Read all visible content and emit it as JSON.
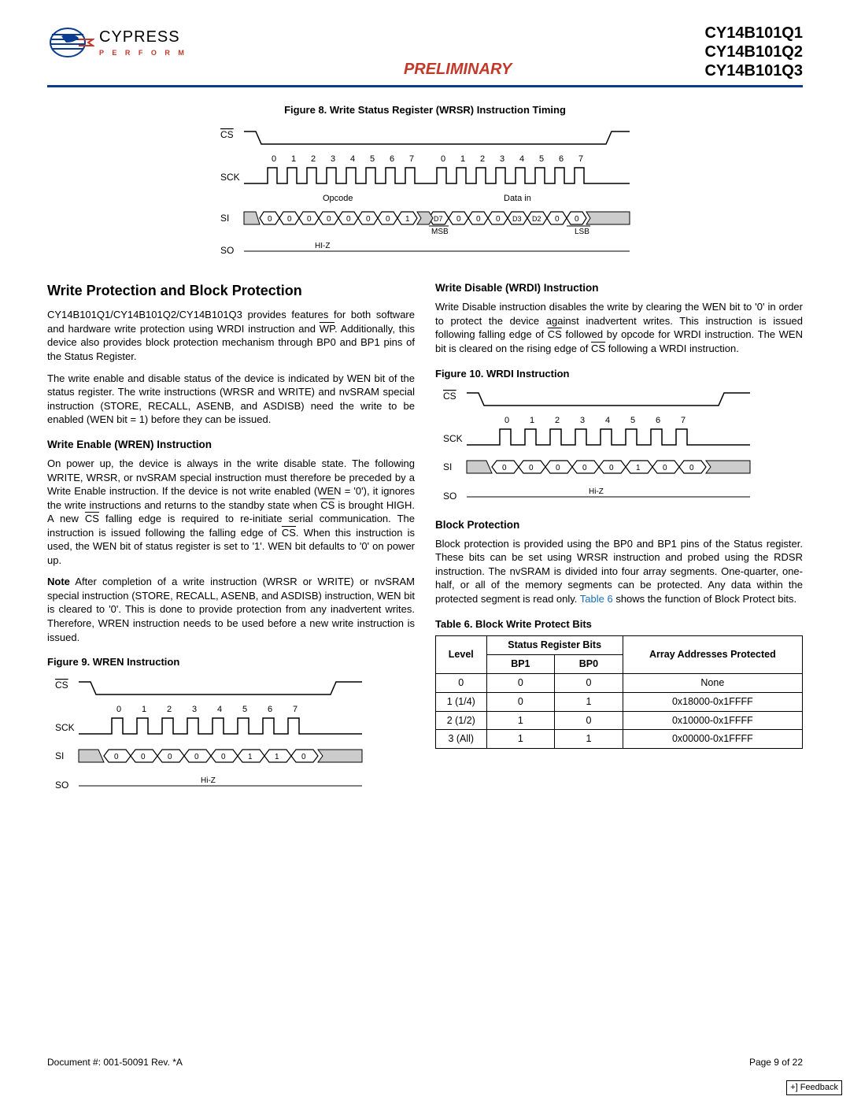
{
  "header": {
    "brand": "CYPRESS",
    "tagline": "P E R F O R M",
    "center": "PRELIMINARY",
    "parts": [
      "CY14B101Q1",
      "CY14B101Q2",
      "CY14B101Q3"
    ]
  },
  "fig8": {
    "caption": "Figure 8.  Write Status Register (WRSR) Instruction Timing",
    "sig_cs": "CS",
    "sig_sck": "SCK",
    "sig_si": "SI",
    "sig_so": "SO",
    "ticks_a": [
      "0",
      "1",
      "2",
      "3",
      "4",
      "5",
      "6",
      "7",
      "0",
      "1",
      "2",
      "3",
      "4",
      "5",
      "6",
      "7"
    ],
    "opcode_lbl": "Opcode",
    "data_lbl": "Data in",
    "msb": "MSB",
    "lsb": "LSB",
    "so_hiz": "HI-Z",
    "si_bits": [
      "0",
      "0",
      "0",
      "0",
      "0",
      "0",
      "0",
      "1",
      "D7",
      "0",
      "0",
      "0",
      "D3",
      "D2",
      "0",
      "0"
    ]
  },
  "left": {
    "h2": "Write Protection and Block Protection",
    "p1": "CY14B101Q1/CY14B101Q2/CY14B101Q3 provides features for both software and hardware write protection using WRDI instruction and WP. Additionally, this device also provides block protection mechanism through BP0 and BP1 pins of the Status Register.",
    "p2": "The write enable and disable status of the device is indicated by WEN bit of the status register. The write instructions (WRSR and WRITE) and nvSRAM special instruction (STORE, RECALL, ASENB, and ASDISB) need the write to be enabled (WEN bit = 1) before they can be issued.",
    "h3_wren": "Write Enable (WREN) Instruction",
    "p3": "On power up, the device is always in the write disable state. The following WRITE, WRSR, or nvSRAM special instruction must therefore be preceded by a Write Enable instruction. If the device is not write enabled (WEN = '0'), it ignores the write instructions and returns to the standby state when CS is brought HIGH. A new CS falling edge is required to re-initiate serial communication. The instruction is issued following the falling edge of CS. When this instruction is used, the WEN bit of status register is set to '1'. WEN bit defaults to '0' on power up.",
    "p4a": "Note",
    "p4b": " After completion of a write instruction (WRSR or WRITE) or nvSRAM special instruction (STORE, RECALL, ASENB, and ASDISB) instruction, WEN bit is cleared to '0'. This is done to provide protection from any inadvertent writes. Therefore, WREN instruction needs to be used before a new write instruction is issued.",
    "fig9_cap": "Figure 9.  WREN Instruction",
    "fig9": {
      "ticks": [
        "0",
        "1",
        "2",
        "3",
        "4",
        "5",
        "6",
        "7"
      ],
      "si_bits": [
        "0",
        "0",
        "0",
        "0",
        "0",
        "1",
        "1",
        "0"
      ],
      "hiz": "Hi-Z"
    }
  },
  "right": {
    "h3_wrdi": "Write Disable (WRDI) Instruction",
    "p1": "Write Disable instruction disables the write by clearing the WEN bit to '0' in order to protect the device against inadvertent writes. This instruction is issued following falling edge of CS followed by opcode for WRDI instruction. The WEN bit is cleared on the rising edge of CS following a WRDI instruction.",
    "fig10_cap": "Figure 10.  WRDI Instruction",
    "fig10": {
      "ticks": [
        "0",
        "1",
        "2",
        "3",
        "4",
        "5",
        "6",
        "7"
      ],
      "si_bits": [
        "0",
        "0",
        "0",
        "0",
        "0",
        "1",
        "0",
        "0"
      ],
      "hiz": "Hi-Z"
    },
    "h3_bp": "Block Protection",
    "p2a": "Block protection is provided using the BP0 and BP1 pins of the Status register. These bits can be set using WRSR instruction and probed using the RDSR instruction. The nvSRAM is divided into four array segments. One-quarter, one-half, or all of the memory segments can be protected. Any data within the protected segment is read only. ",
    "p2b": "Table 6",
    "p2c": " shows the function of Block Protect bits.",
    "tbl_cap": "Table 6.  Block Write Protect Bits",
    "tbl": {
      "h_level": "Level",
      "h_sr": "Status Register Bits",
      "h_bp1": "BP1",
      "h_bp0": "BP0",
      "h_addr": "Array Addresses Protected",
      "rows": [
        {
          "level": "0",
          "bp1": "0",
          "bp0": "0",
          "addr": "None"
        },
        {
          "level": "1 (1/4)",
          "bp1": "0",
          "bp0": "1",
          "addr": "0x18000-0x1FFFF"
        },
        {
          "level": "2 (1/2)",
          "bp1": "1",
          "bp0": "0",
          "addr": "0x10000-0x1FFFF"
        },
        {
          "level": "3 (All)",
          "bp1": "1",
          "bp0": "1",
          "addr": "0x00000-0x1FFFF"
        }
      ]
    }
  },
  "footer": {
    "doc": "Document #: 001-50091 Rev. *A",
    "page": "Page 9 of 22",
    "fb": "+] Feedback"
  }
}
